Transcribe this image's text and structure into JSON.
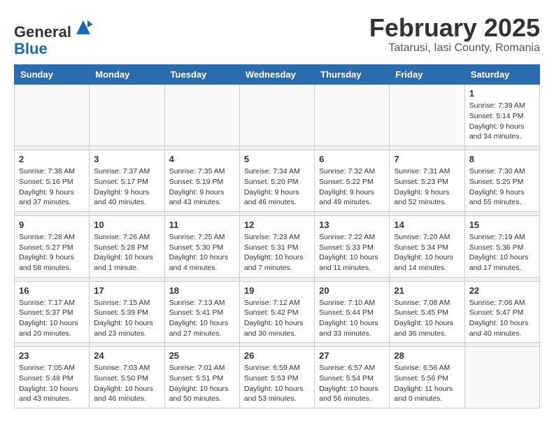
{
  "logo": {
    "general": "General",
    "blue": "Blue"
  },
  "title": "February 2025",
  "subtitle": "Tatarusi, Iasi County, Romania",
  "days_of_week": [
    "Sunday",
    "Monday",
    "Tuesday",
    "Wednesday",
    "Thursday",
    "Friday",
    "Saturday"
  ],
  "weeks": [
    [
      {
        "day": "",
        "info": ""
      },
      {
        "day": "",
        "info": ""
      },
      {
        "day": "",
        "info": ""
      },
      {
        "day": "",
        "info": ""
      },
      {
        "day": "",
        "info": ""
      },
      {
        "day": "",
        "info": ""
      },
      {
        "day": "1",
        "info": "Sunrise: 7:39 AM\nSunset: 5:14 PM\nDaylight: 9 hours and 34 minutes."
      }
    ],
    [
      {
        "day": "2",
        "info": "Sunrise: 7:38 AM\nSunset: 5:16 PM\nDaylight: 9 hours and 37 minutes."
      },
      {
        "day": "3",
        "info": "Sunrise: 7:37 AM\nSunset: 5:17 PM\nDaylight: 9 hours and 40 minutes."
      },
      {
        "day": "4",
        "info": "Sunrise: 7:35 AM\nSunset: 5:19 PM\nDaylight: 9 hours and 43 minutes."
      },
      {
        "day": "5",
        "info": "Sunrise: 7:34 AM\nSunset: 5:20 PM\nDaylight: 9 hours and 46 minutes."
      },
      {
        "day": "6",
        "info": "Sunrise: 7:32 AM\nSunset: 5:22 PM\nDaylight: 9 hours and 49 minutes."
      },
      {
        "day": "7",
        "info": "Sunrise: 7:31 AM\nSunset: 5:23 PM\nDaylight: 9 hours and 52 minutes."
      },
      {
        "day": "8",
        "info": "Sunrise: 7:30 AM\nSunset: 5:25 PM\nDaylight: 9 hours and 55 minutes."
      }
    ],
    [
      {
        "day": "9",
        "info": "Sunrise: 7:28 AM\nSunset: 5:27 PM\nDaylight: 9 hours and 58 minutes."
      },
      {
        "day": "10",
        "info": "Sunrise: 7:26 AM\nSunset: 5:28 PM\nDaylight: 10 hours and 1 minute."
      },
      {
        "day": "11",
        "info": "Sunrise: 7:25 AM\nSunset: 5:30 PM\nDaylight: 10 hours and 4 minutes."
      },
      {
        "day": "12",
        "info": "Sunrise: 7:23 AM\nSunset: 5:31 PM\nDaylight: 10 hours and 7 minutes."
      },
      {
        "day": "13",
        "info": "Sunrise: 7:22 AM\nSunset: 5:33 PM\nDaylight: 10 hours and 11 minutes."
      },
      {
        "day": "14",
        "info": "Sunrise: 7:20 AM\nSunset: 5:34 PM\nDaylight: 10 hours and 14 minutes."
      },
      {
        "day": "15",
        "info": "Sunrise: 7:19 AM\nSunset: 5:36 PM\nDaylight: 10 hours and 17 minutes."
      }
    ],
    [
      {
        "day": "16",
        "info": "Sunrise: 7:17 AM\nSunset: 5:37 PM\nDaylight: 10 hours and 20 minutes."
      },
      {
        "day": "17",
        "info": "Sunrise: 7:15 AM\nSunset: 5:39 PM\nDaylight: 10 hours and 23 minutes."
      },
      {
        "day": "18",
        "info": "Sunrise: 7:13 AM\nSunset: 5:41 PM\nDaylight: 10 hours and 27 minutes."
      },
      {
        "day": "19",
        "info": "Sunrise: 7:12 AM\nSunset: 5:42 PM\nDaylight: 10 hours and 30 minutes."
      },
      {
        "day": "20",
        "info": "Sunrise: 7:10 AM\nSunset: 5:44 PM\nDaylight: 10 hours and 33 minutes."
      },
      {
        "day": "21",
        "info": "Sunrise: 7:08 AM\nSunset: 5:45 PM\nDaylight: 10 hours and 36 minutes."
      },
      {
        "day": "22",
        "info": "Sunrise: 7:06 AM\nSunset: 5:47 PM\nDaylight: 10 hours and 40 minutes."
      }
    ],
    [
      {
        "day": "23",
        "info": "Sunrise: 7:05 AM\nSunset: 5:48 PM\nDaylight: 10 hours and 43 minutes."
      },
      {
        "day": "24",
        "info": "Sunrise: 7:03 AM\nSunset: 5:50 PM\nDaylight: 10 hours and 46 minutes."
      },
      {
        "day": "25",
        "info": "Sunrise: 7:01 AM\nSunset: 5:51 PM\nDaylight: 10 hours and 50 minutes."
      },
      {
        "day": "26",
        "info": "Sunrise: 6:59 AM\nSunset: 5:53 PM\nDaylight: 10 hours and 53 minutes."
      },
      {
        "day": "27",
        "info": "Sunrise: 6:57 AM\nSunset: 5:54 PM\nDaylight: 10 hours and 56 minutes."
      },
      {
        "day": "28",
        "info": "Sunrise: 6:56 AM\nSunset: 5:56 PM\nDaylight: 11 hours and 0 minutes."
      },
      {
        "day": "",
        "info": ""
      }
    ]
  ]
}
